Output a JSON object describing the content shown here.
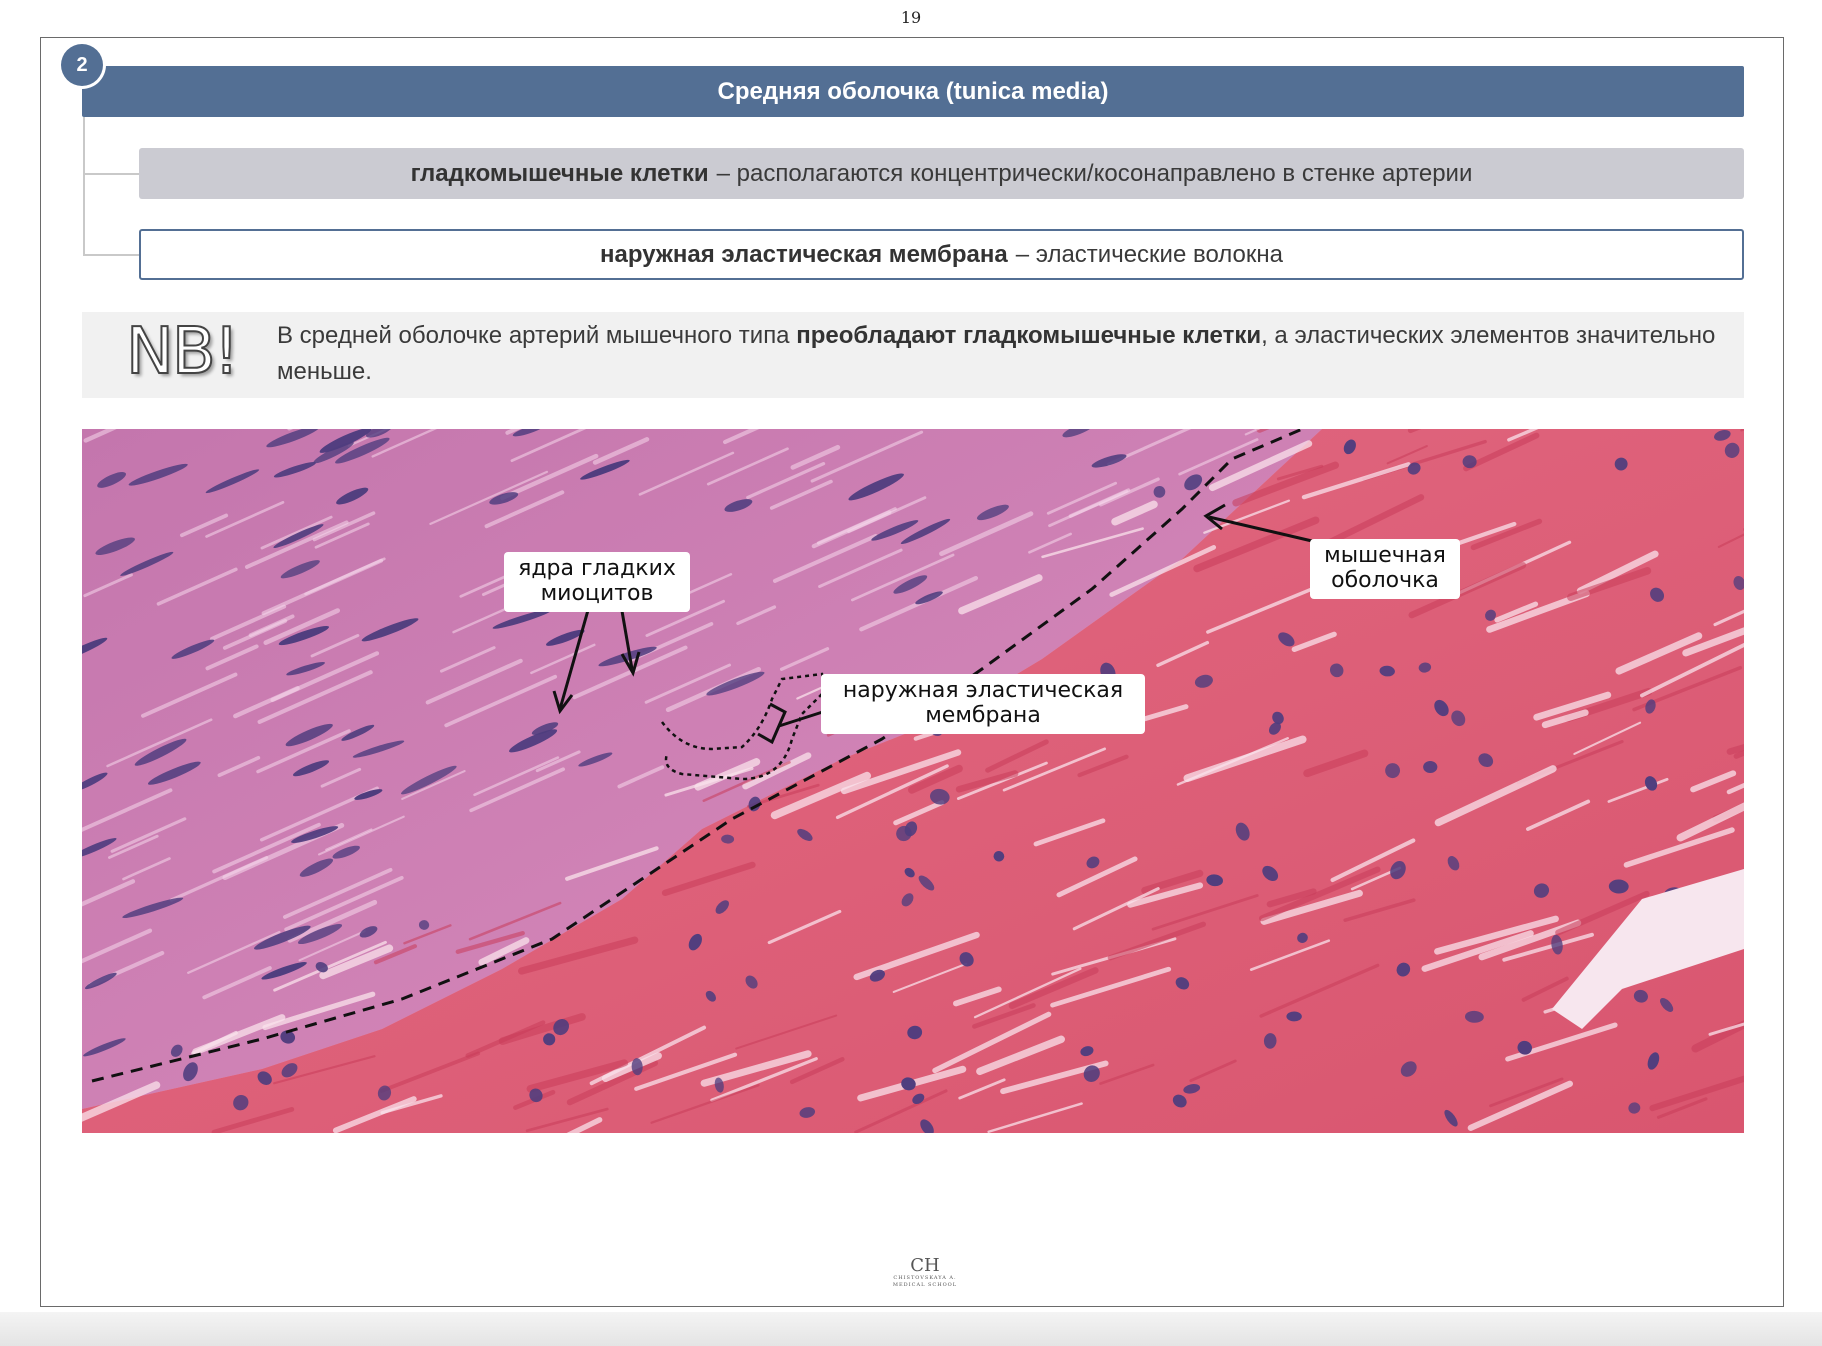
{
  "page": {
    "number": "19"
  },
  "section": {
    "badge": "2",
    "title": "Средняя оболочка (tunica media)",
    "rows": [
      {
        "term": "гладкомышечные клетки",
        "desc": "– располагаются концентрически/косонаправлено в стенке артерии"
      },
      {
        "term": "наружная эластическая мембрана",
        "desc": "– эластические волокна"
      }
    ]
  },
  "nb": {
    "logo": "NB!",
    "text_before": "В средней оболочке артерий мышечного типа ",
    "text_bold": "преобладают гладкомышечные клетки",
    "text_after": ", а эластических элементов значительно меньше."
  },
  "micrograph": {
    "labels": {
      "nuclei_line1": "ядра гладких",
      "nuclei_line2": "миоцитов",
      "muscle_line1": "мышечная",
      "muscle_line2": "оболочка",
      "membrane_line1": "наружная эластическая",
      "membrane_line2": "мембрана"
    },
    "colors": {
      "media": "#cf7fb2",
      "adventitia": "#df6078",
      "nuclei": "#4f3d7e"
    }
  },
  "footer": {
    "logo_monogram": "CH",
    "logo_name": "CHISTOVSKAYA A.",
    "logo_sub": "MEDICAL SCHOOL"
  }
}
